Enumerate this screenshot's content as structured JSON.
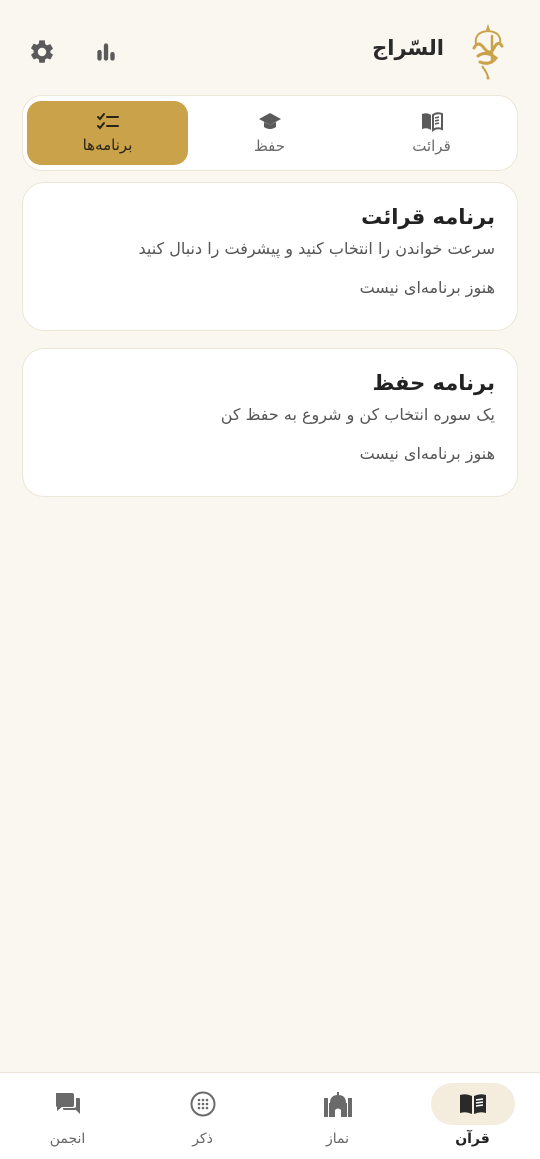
{
  "header": {
    "title": "السّراج",
    "logo_icon": "siraj-calligraphy-logo",
    "settings_icon": "gear-icon",
    "stats_icon": "bar-chart-icon"
  },
  "tabs": [
    {
      "label": "قرائت",
      "icon": "open-book-icon",
      "active": false
    },
    {
      "label": "حفظ",
      "icon": "graduation-cap-icon",
      "active": false
    },
    {
      "label": "برنامه‌ها",
      "icon": "checklist-icon",
      "active": true
    }
  ],
  "cards": [
    {
      "title": "برنامه قرائت",
      "subtitle": "سرعت خواندن را انتخاب کنید و پیشرفت را دنبال کنید",
      "empty": "هنوز برنامه‌ای نیست"
    },
    {
      "title": "برنامه حفظ",
      "subtitle": "یک سوره انتخاب کن و شروع به حفظ کن",
      "empty": "هنوز برنامه‌ای نیست"
    }
  ],
  "bottom_nav": [
    {
      "label": "قرآن",
      "icon": "quran-book-icon",
      "active": true
    },
    {
      "label": "نماز",
      "icon": "mosque-icon",
      "active": false
    },
    {
      "label": "ذکر",
      "icon": "tasbih-icon",
      "active": false
    },
    {
      "label": "انجمن",
      "icon": "chat-bubbles-icon",
      "active": false
    }
  ],
  "colors": {
    "background": "#faf7f0",
    "accent": "#c9a24a",
    "card": "#ffffff",
    "border": "#ece6d8"
  }
}
